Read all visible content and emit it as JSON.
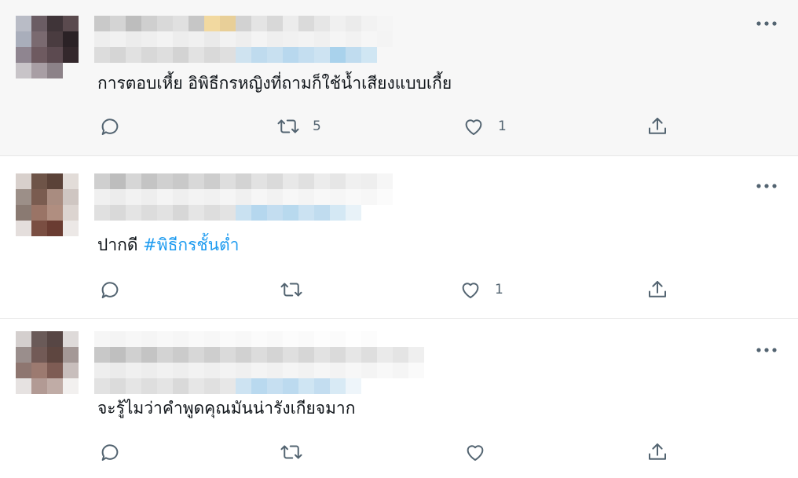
{
  "tweets": [
    {
      "text": "การตอบเหี้ย อิพิธีกรหญิงที่ถามก็ใช้น้ำเสียงแบบเกี้ย",
      "hashtag": "",
      "retweet_count": "5",
      "like_count": "1"
    },
    {
      "text": "ปากดี ",
      "hashtag": "#พิธีกรชั้นต่ำ",
      "retweet_count": "",
      "like_count": "1"
    },
    {
      "text": "จะรู้ไมว่าคำพูดคุณมันน่ารังเกียจมาก",
      "hashtag": "",
      "retweet_count": "",
      "like_count": ""
    }
  ],
  "colors": {
    "icon": "#536471",
    "hashtag": "#1d9bf0",
    "highlight_bg": "#f7f7f7"
  },
  "icons": [
    "reply-icon",
    "retweet-icon",
    "like-icon",
    "share-icon",
    "more-icon"
  ]
}
